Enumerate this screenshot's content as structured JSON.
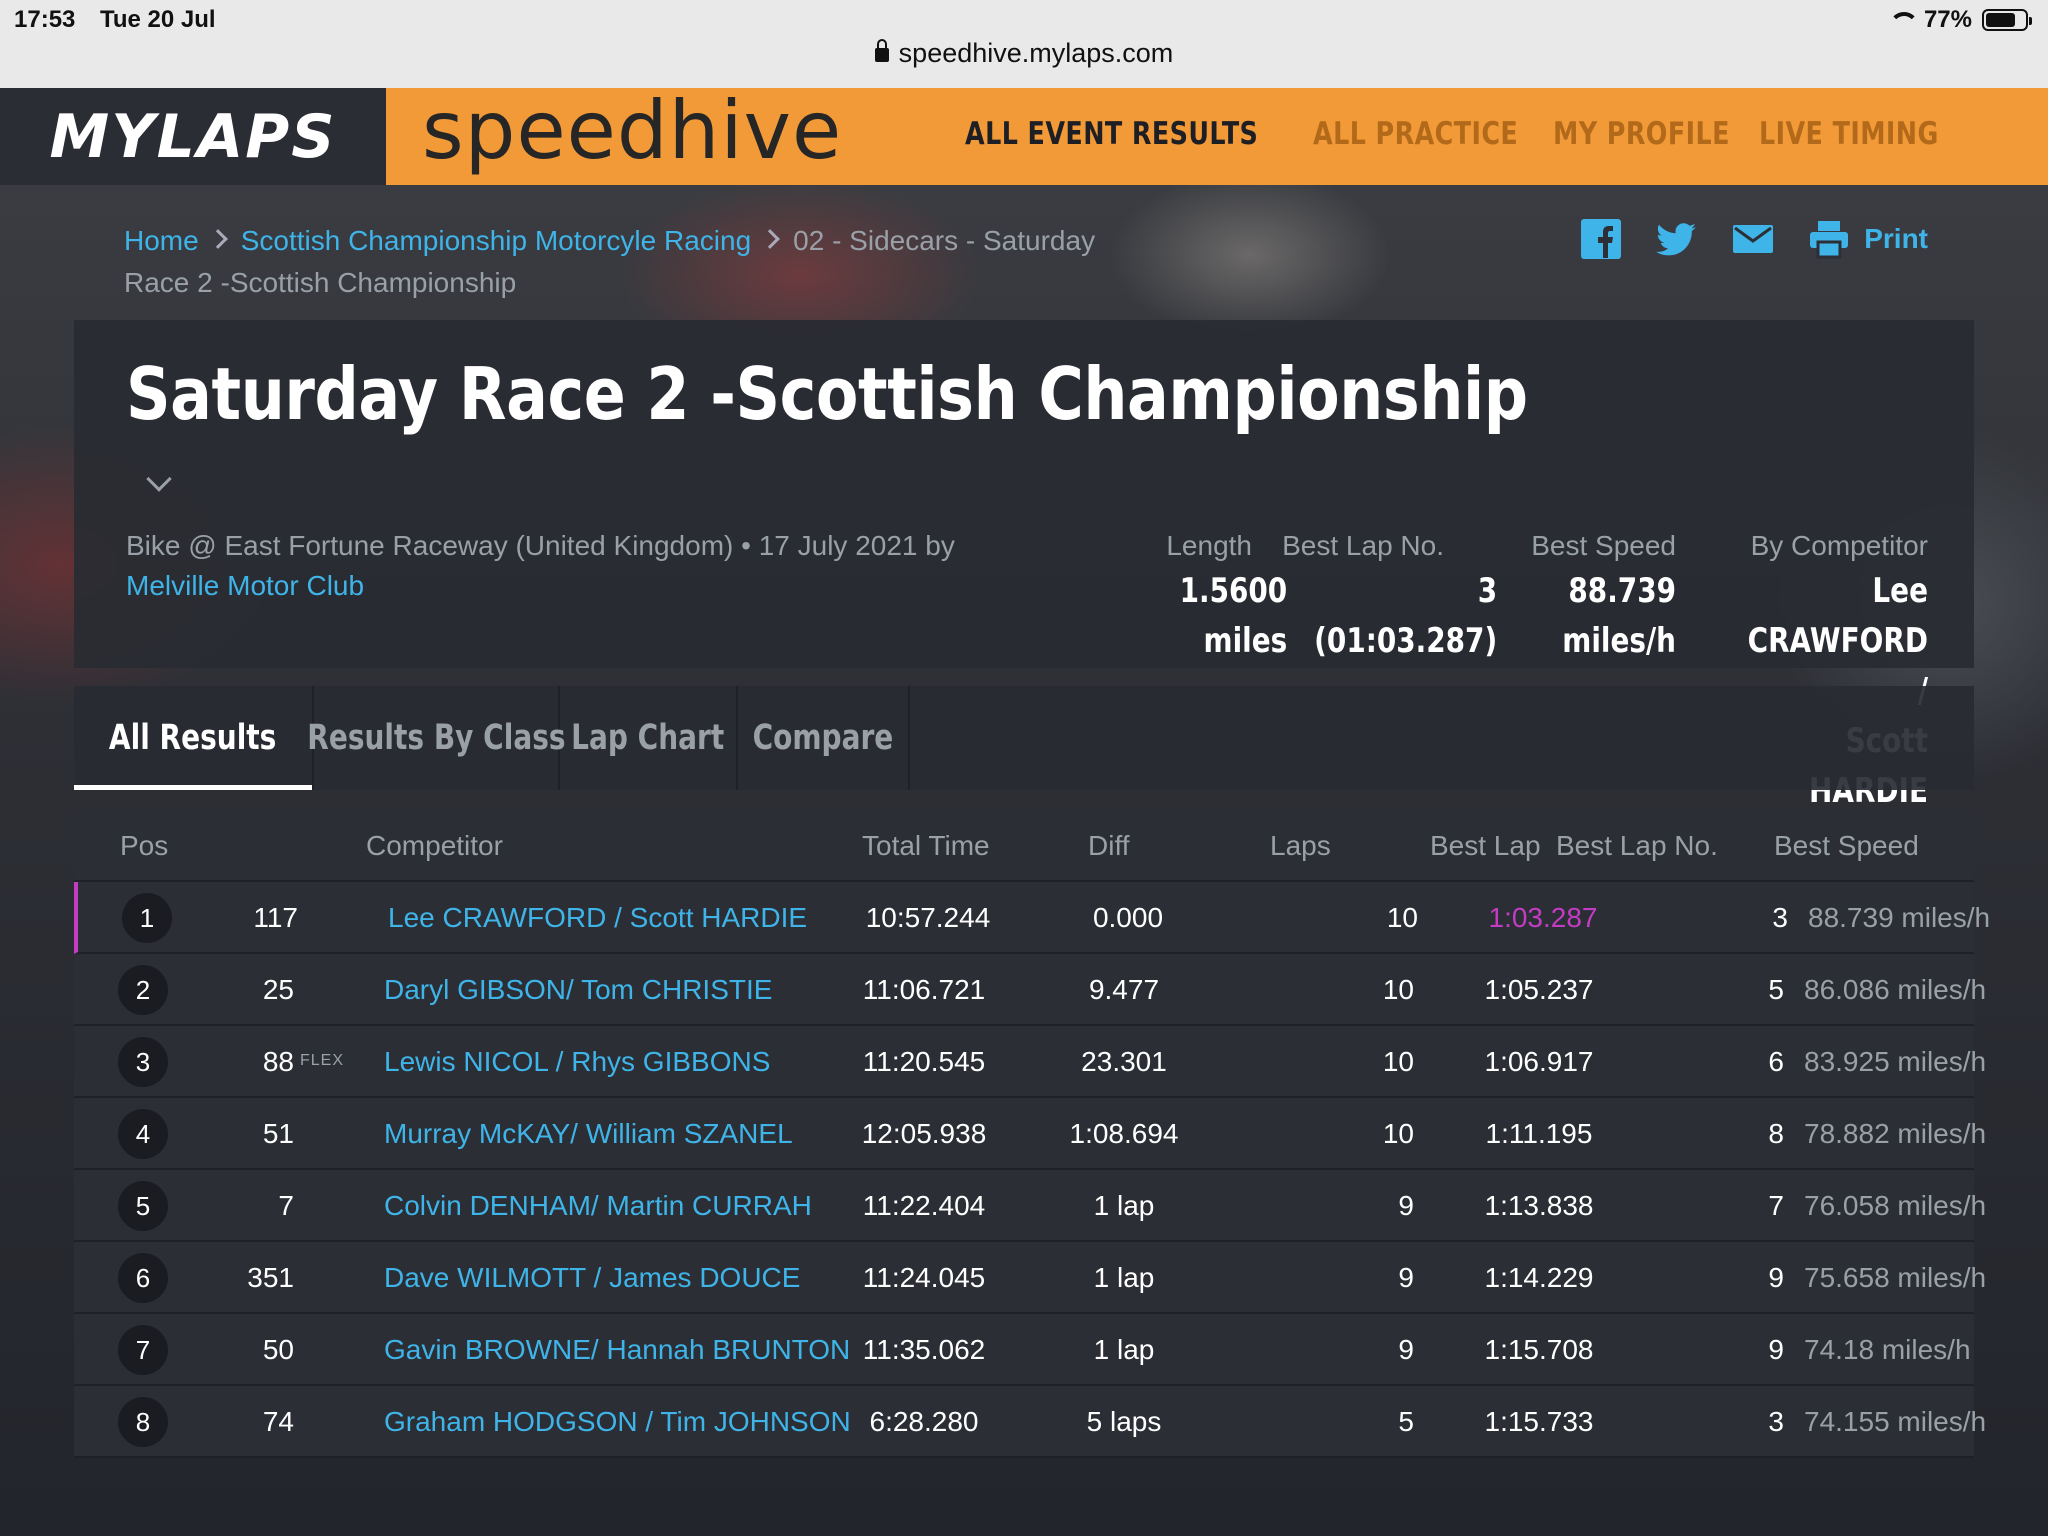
{
  "status": {
    "time": "17:53",
    "date": "Tue 20 Jul",
    "battery": "77%"
  },
  "url": "speedhive.mylaps.com",
  "header": {
    "mylaps": "MYLAPS",
    "speedhive": "speedhive",
    "nav": [
      "ALL EVENT RESULTS",
      "ALL PRACTICE",
      "MY PROFILE",
      "LIVE TIMING"
    ]
  },
  "breadcrumb": {
    "home": "Home",
    "event": "Scottish Championship Motorcyle Racing",
    "session": "02 - Sidecars - Saturday",
    "current": "Race 2 -Scottish Championship"
  },
  "share": {
    "print": "Print"
  },
  "card": {
    "title": "Saturday Race 2 -Scottish Championship",
    "meta_text": "Bike @ East Fortune Raceway (United Kingdom) • 17 July 2021 by",
    "organizer": "Melville Motor Club",
    "stats": {
      "length_label": "Length",
      "length_value": "1.5600\nmiles",
      "best_lap_no_label": "Best Lap No.",
      "best_lap_no_value": "3 (01:03.287)",
      "best_speed_label": "Best Speed",
      "best_speed_value": "88.739 miles/h",
      "by_competitor_label": "By Competitor",
      "by_competitor_value": "Lee CRAWFORD /\nScott HARDIE"
    }
  },
  "tabs": [
    "All Results",
    "Results By Class",
    "Lap Chart",
    "Compare"
  ],
  "table": {
    "headers": {
      "pos": "Pos",
      "competitor": "Competitor",
      "total": "Total Time",
      "diff": "Diff",
      "laps": "Laps",
      "best_lap": "Best Lap",
      "best_lap_no": "Best Lap No.",
      "best_speed": "Best Speed"
    },
    "rows": [
      {
        "pos": "1",
        "num": "117",
        "flag": "",
        "name": "Lee CRAWFORD / Scott HARDIE",
        "total": "10:57.244",
        "diff": "0.000",
        "laps": "10",
        "best": "1:03.287",
        "bln": "3",
        "speed": "88.739 miles/h"
      },
      {
        "pos": "2",
        "num": "25",
        "flag": "",
        "name": "Daryl GIBSON/ Tom CHRISTIE",
        "total": "11:06.721",
        "diff": "9.477",
        "laps": "10",
        "best": "1:05.237",
        "bln": "5",
        "speed": "86.086 miles/h"
      },
      {
        "pos": "3",
        "num": "88",
        "flag": "FLEX",
        "name": "Lewis NICOL / Rhys GIBBONS",
        "total": "11:20.545",
        "diff": "23.301",
        "laps": "10",
        "best": "1:06.917",
        "bln": "6",
        "speed": "83.925 miles/h"
      },
      {
        "pos": "4",
        "num": "51",
        "flag": "",
        "name": "Murray McKAY/ William SZANEL",
        "total": "12:05.938",
        "diff": "1:08.694",
        "laps": "10",
        "best": "1:11.195",
        "bln": "8",
        "speed": "78.882 miles/h"
      },
      {
        "pos": "5",
        "num": "7",
        "flag": "",
        "name": "Colvin DENHAM/ Martin CURRAH",
        "total": "11:22.404",
        "diff": "1 lap",
        "laps": "9",
        "best": "1:13.838",
        "bln": "7",
        "speed": "76.058 miles/h"
      },
      {
        "pos": "6",
        "num": "351",
        "flag": "",
        "name": "Dave WILMOTT / James DOUCE",
        "total": "11:24.045",
        "diff": "1 lap",
        "laps": "9",
        "best": "1:14.229",
        "bln": "9",
        "speed": "75.658 miles/h"
      },
      {
        "pos": "7",
        "num": "50",
        "flag": "",
        "name": "Gavin BROWNE/ Hannah BRUNTON",
        "total": "11:35.062",
        "diff": "1 lap",
        "laps": "9",
        "best": "1:15.708",
        "bln": "9",
        "speed": "74.18 miles/h"
      },
      {
        "pos": "8",
        "num": "74",
        "flag": "",
        "name": "Graham HODGSON / Tim JOHNSON",
        "total": "6:28.280",
        "diff": "5 laps",
        "laps": "5",
        "best": "1:15.733",
        "bln": "3",
        "speed": "74.155 miles/h"
      }
    ]
  },
  "colors": {
    "accent": "#f29a38",
    "link": "#3fb4e8",
    "fastest": "#c33cc3"
  }
}
